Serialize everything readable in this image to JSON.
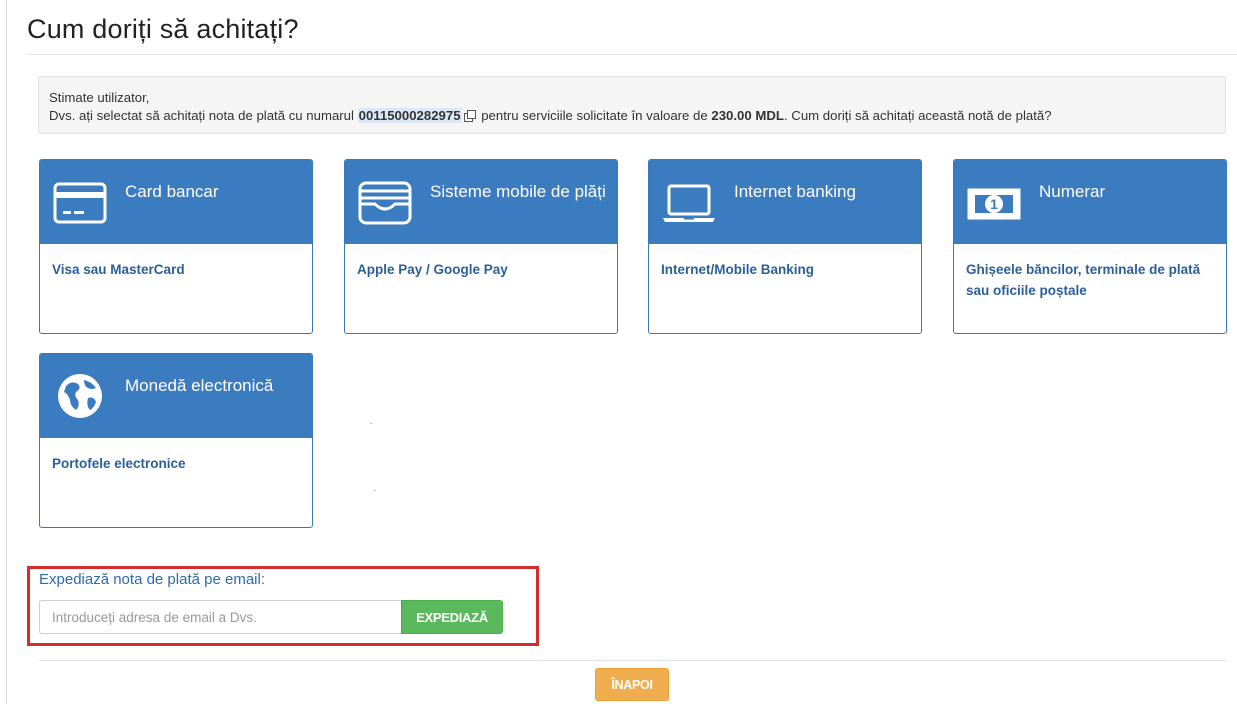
{
  "page": {
    "title": "Cum doriți să achitați?"
  },
  "notice": {
    "greeting": "Stimate utilizator,",
    "text_before_invoice": "Dvs. ați selectat să achitați nota de plată cu numarul ",
    "invoice_number": "00115000282975",
    "text_after_invoice": " pentru serviciile solicitate în valoare de ",
    "amount": "230.00 MDL",
    "text_end": ". Cum doriți să achitați această notă de plată?"
  },
  "payment_methods": [
    {
      "title": "Card bancar",
      "description": "Visa sau MasterCard",
      "icon": "credit-card-icon"
    },
    {
      "title": "Sisteme mobile de plăți",
      "description": "Apple Pay / Google Pay",
      "icon": "wallet-icon"
    },
    {
      "title": "Internet banking",
      "description": "Internet/Mobile Banking",
      "icon": "laptop-icon"
    },
    {
      "title": "Numerar",
      "description": "Ghișeele băncilor, terminale de plată sau oficiile poștale",
      "icon": "banknote-icon"
    },
    {
      "title": "Monedă electronică",
      "description": "Portofele electronice",
      "icon": "globe-icon"
    }
  ],
  "email": {
    "label": "Expediază nota de plată pe email:",
    "placeholder": "Introduceți adresa de email a Dvs.",
    "value": "",
    "send_label": "EXPEDIAZĂ"
  },
  "footer": {
    "back_label": "ÎNAPOI"
  },
  "colors": {
    "card_header": "#3b7bbf",
    "send_button": "#5cb85c",
    "back_button": "#f0ad4e",
    "highlight_box": "#d32f2f"
  }
}
